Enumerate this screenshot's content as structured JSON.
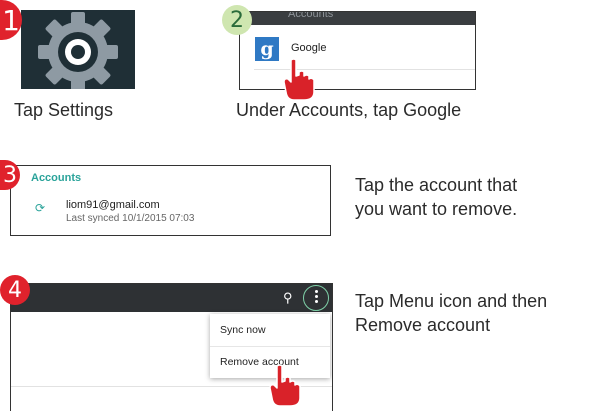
{
  "steps": {
    "step1": {
      "number": "1",
      "caption": "Tap Settings"
    },
    "step2": {
      "number": "2",
      "caption": "Under Accounts, tap Google",
      "header_text": "Accounts",
      "item_label": "Google",
      "item_icon": "google-g-icon"
    },
    "step3": {
      "number": "3",
      "section_title": "Accounts",
      "email": "liom91@gmail.com",
      "last_synced": "Last synced 10/1/2015 07:03",
      "description_line1": "Tap the account that",
      "description_line2": "you want to remove."
    },
    "step4": {
      "number": "4",
      "menu_items": [
        "Sync now",
        "Remove account"
      ],
      "description_line1": "Tap Menu icon and then",
      "description_line2": "Remove account"
    }
  },
  "colors": {
    "badge_red": "#e0222c",
    "badge_green": "#cfe6b0",
    "accent_teal": "#2aa39a",
    "toolbar_dark": "#2e3134",
    "hand_red": "#d92229"
  },
  "icons": [
    "settings-gear-icon",
    "google-g-icon",
    "sync-icon",
    "search-icon",
    "overflow-menu-icon",
    "pointing-hand-icon"
  ]
}
